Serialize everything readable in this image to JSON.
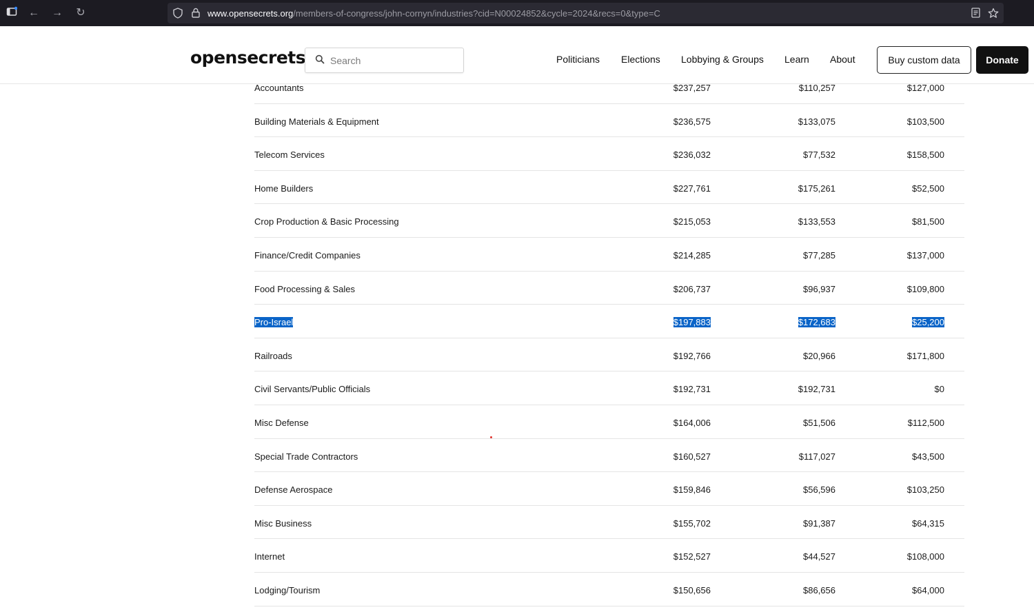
{
  "browser": {
    "url_domain": "www.opensecrets.org",
    "url_path": "/members-of-congress/john-cornyn/industries?cid=N00024852&cycle=2024&recs=0&type=C"
  },
  "header": {
    "logo_open": "open",
    "logo_secrets": "secrets",
    "search_placeholder": "Search",
    "nav": [
      "Politicians",
      "Elections",
      "Lobbying & Groups",
      "Learn",
      "About"
    ],
    "buy_button": "Buy custom data",
    "donate_button": "Donate"
  },
  "table": {
    "rows": [
      {
        "industry": "Accountants",
        "total": "$237,257",
        "individuals": "$110,257",
        "pacs": "$127,000",
        "selected": false
      },
      {
        "industry": "Building Materials & Equipment",
        "total": "$236,575",
        "individuals": "$133,075",
        "pacs": "$103,500",
        "selected": false
      },
      {
        "industry": "Telecom Services",
        "total": "$236,032",
        "individuals": "$77,532",
        "pacs": "$158,500",
        "selected": false
      },
      {
        "industry": "Home Builders",
        "total": "$227,761",
        "individuals": "$175,261",
        "pacs": "$52,500",
        "selected": false
      },
      {
        "industry": "Crop Production & Basic Processing",
        "total": "$215,053",
        "individuals": "$133,553",
        "pacs": "$81,500",
        "selected": false
      },
      {
        "industry": "Finance/Credit Companies",
        "total": "$214,285",
        "individuals": "$77,285",
        "pacs": "$137,000",
        "selected": false
      },
      {
        "industry": "Food Processing & Sales",
        "total": "$206,737",
        "individuals": "$96,937",
        "pacs": "$109,800",
        "selected": false
      },
      {
        "industry": "Pro-Israel",
        "total": "$197,883",
        "individuals": "$172,683",
        "pacs": "$25,200",
        "selected": true
      },
      {
        "industry": "Railroads",
        "total": "$192,766",
        "individuals": "$20,966",
        "pacs": "$171,800",
        "selected": false
      },
      {
        "industry": "Civil Servants/Public Officials",
        "total": "$192,731",
        "individuals": "$192,731",
        "pacs": "$0",
        "selected": false
      },
      {
        "industry": "Misc Defense",
        "total": "$164,006",
        "individuals": "$51,506",
        "pacs": "$112,500",
        "selected": false
      },
      {
        "industry": "Special Trade Contractors",
        "total": "$160,527",
        "individuals": "$117,027",
        "pacs": "$43,500",
        "selected": false
      },
      {
        "industry": "Defense Aerospace",
        "total": "$159,846",
        "individuals": "$56,596",
        "pacs": "$103,250",
        "selected": false
      },
      {
        "industry": "Misc Business",
        "total": "$155,702",
        "individuals": "$91,387",
        "pacs": "$64,315",
        "selected": false
      },
      {
        "industry": "Internet",
        "total": "$152,527",
        "individuals": "$44,527",
        "pacs": "$108,000",
        "selected": false
      },
      {
        "industry": "Lodging/Tourism",
        "total": "$150,656",
        "individuals": "$86,656",
        "pacs": "$64,000",
        "selected": false
      }
    ]
  },
  "colors": {
    "selection": "#0a64c8",
    "browser_bg": "#1c1b22",
    "donate_bg": "#111111"
  }
}
